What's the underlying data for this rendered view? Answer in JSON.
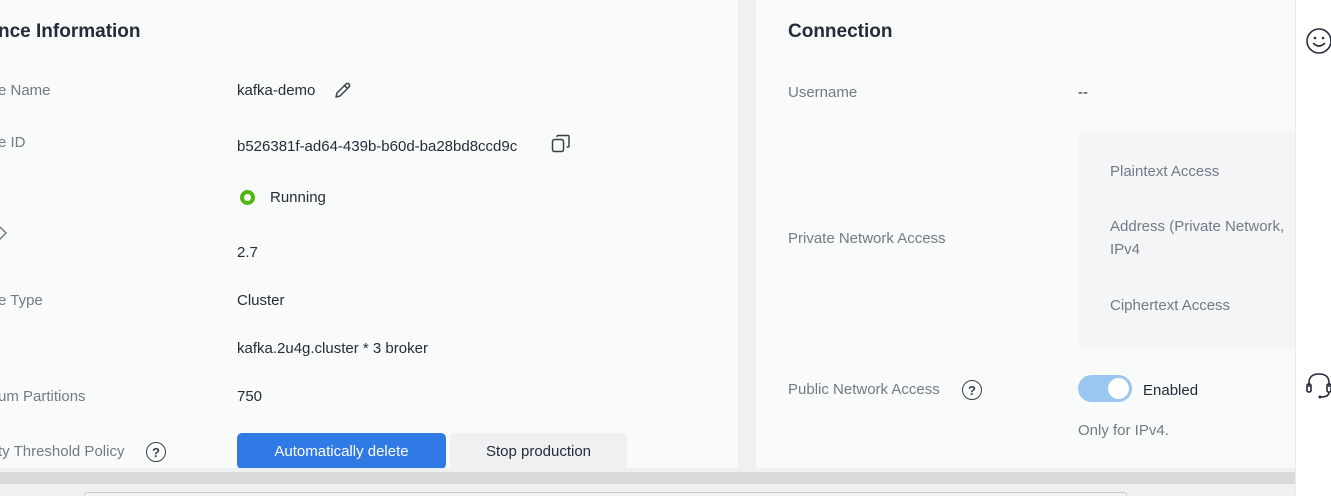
{
  "instance_panel": {
    "title": "nce Information",
    "fields": {
      "name_label": "e Name",
      "name_value": "kafka-demo",
      "id_label": "e ID",
      "id_value": "b526381f-ad64-439b-b60d-ba28bd8ccd9c",
      "status_value": "Running",
      "version_label": "",
      "version_value": "2.7",
      "type_label": "e Type",
      "type_value": "Cluster",
      "flavor_value": "kafka.2u4g.cluster * 3 broker",
      "partitions_label": "um Partitions",
      "partitions_value": "750",
      "threshold_label": "ty Threshold Policy",
      "threshold_help": "?",
      "auto_delete_label": "Automatically delete",
      "stop_production_label": "Stop production"
    },
    "icons": [
      "edit-icon",
      "copy-icon",
      "chevron-right-icon",
      "help-icon"
    ]
  },
  "connection_panel": {
    "title": "Connection",
    "username_label": "Username",
    "username_value": "--",
    "private_label": "Private Network Access",
    "private_box": {
      "plaintext_label": "Plaintext Access",
      "address_line1": "Address (Private Network,",
      "address_line2": "IPv4",
      "ciphertext_label": "Ciphertext Access"
    },
    "public_label": "Public Network Access",
    "public_help": "?",
    "public_toggle_state": "on",
    "public_toggle_label": "Enabled",
    "public_note": "Only for IPv4."
  },
  "right_rail": {
    "icons": [
      "smiley-icon",
      "headset-icon"
    ]
  },
  "colors": {
    "accent": "#2f7ae5",
    "status_running": "#50b714",
    "toggle_on": "#9cc6f2"
  }
}
